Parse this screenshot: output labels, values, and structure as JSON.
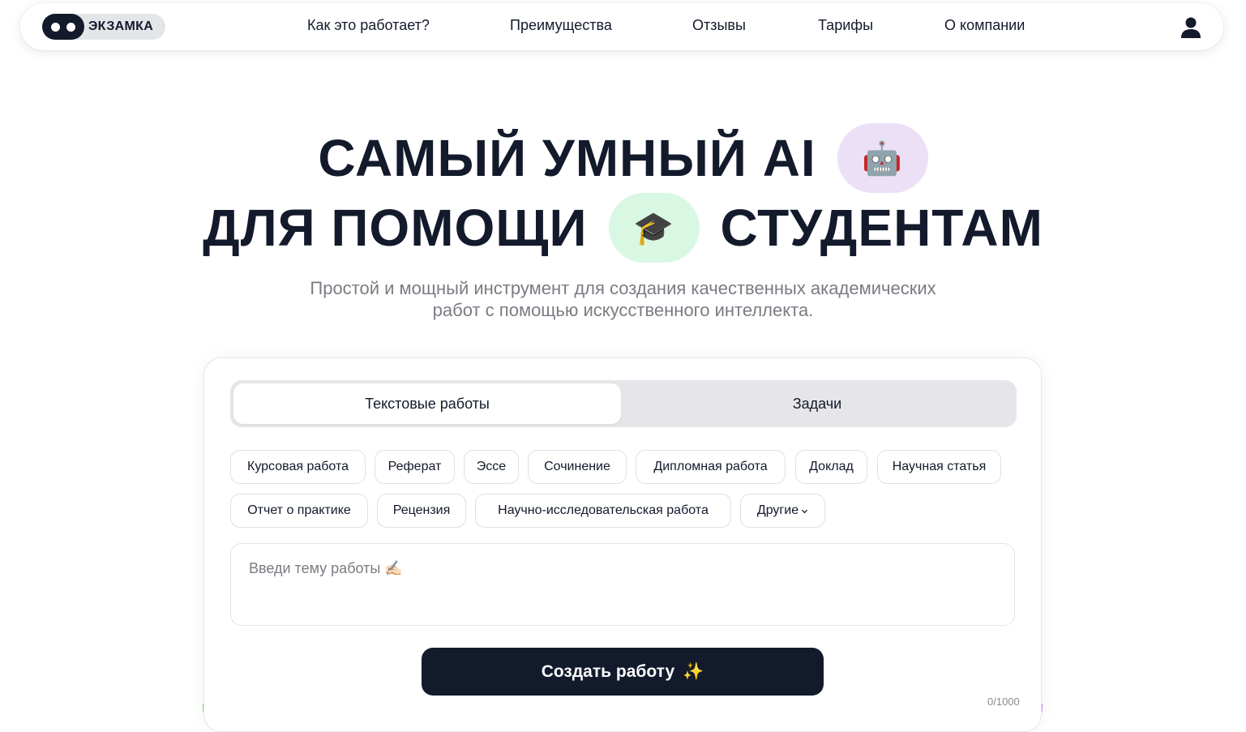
{
  "header": {
    "brand": "ЭКЗАМКА",
    "nav": [
      {
        "label": "Как это работает?"
      },
      {
        "label": "Преимущества"
      },
      {
        "label": "Отзывы"
      },
      {
        "label": "Тарифы"
      },
      {
        "label": "О компании"
      }
    ],
    "account_icon": "user-icon"
  },
  "hero": {
    "line1": "САМЫЙ УМНЫЙ AI",
    "line1_emoji": "🤖",
    "line2_left": "ДЛЯ ПОМОЩИ",
    "line2_emoji": "🎓",
    "line2_right": "СТУДЕНТАМ",
    "subtitle_line1": "Простой и мощный инструмент для создания качественных академических",
    "subtitle_line2": "работ с помощью искусственного интеллекта."
  },
  "form": {
    "tabs": [
      {
        "label": "Текстовые работы",
        "active": true
      },
      {
        "label": "Задачи",
        "active": false
      }
    ],
    "work_types": [
      "Курсовая работа",
      "Реферат",
      "Эссе",
      "Сочинение",
      "Дипломная работа",
      "Доклад",
      "Научная статья",
      "Отчет о практике",
      "Рецензия",
      "Научно-исследовательская работа",
      "Другие"
    ],
    "topic_placeholder": "Введи тему работы",
    "topic_emoji": "✍🏻",
    "submit_label": "Создать работу",
    "submit_icon": "✨",
    "char_counter": "0/1000"
  },
  "colors": {
    "primary": "#131a2b",
    "robot_bg": "#ece0f7",
    "cap_bg": "#d9f8e4",
    "muted_text": "#7b7c83"
  }
}
